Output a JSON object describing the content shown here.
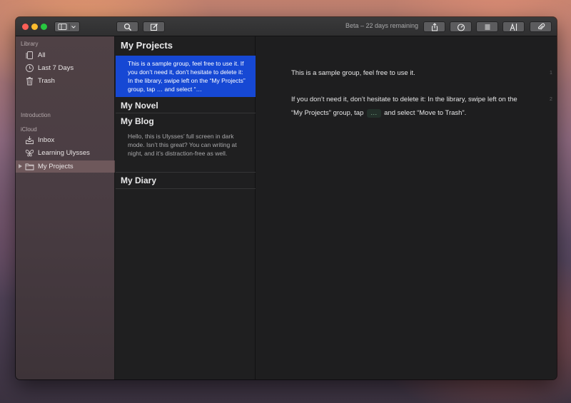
{
  "window": {
    "beta_text": "Beta – 22 days remaining"
  },
  "toolbar": {
    "sidebar_toggle_icon": "sidebar-icon",
    "search_icon": "search-icon",
    "compose_icon": "compose-icon",
    "share_icon": "share-icon",
    "stats_icon": "speedometer-icon",
    "list_icon": "list-icon",
    "text_icon": "text-cursor-icon",
    "attach_icon": "paperclip-icon"
  },
  "sidebar": {
    "library_header": "Library",
    "library_items": [
      {
        "label": "All",
        "icon": "stack-icon"
      },
      {
        "label": "Last 7 Days",
        "icon": "clock-icon"
      },
      {
        "label": "Trash",
        "icon": "trash-icon"
      }
    ],
    "introduction_header": "Introduction",
    "icloud_header": "iCloud",
    "icloud_items": [
      {
        "label": "Inbox",
        "icon": "inbox-icon"
      },
      {
        "label": "Learning Ulysses",
        "icon": "butterfly-icon"
      },
      {
        "label": "My Projects",
        "icon": "folder-icon",
        "selected": true
      }
    ]
  },
  "sheets": {
    "group_title": "My Projects",
    "selected_sheet_text": "This is a sample group, feel free to use it. If you don’t need it, don’t hesitate to delete it: In the library, swipe left on the “My Projects” group, tap … and select “…",
    "groups": [
      {
        "title": "My Novel"
      },
      {
        "title": "My Blog",
        "preview": "Hello, this is Ulysses’ full screen in dark mode. Isn’t this great? You can writing at night, and it’s distraction-free as well."
      },
      {
        "title": "My Diary"
      }
    ]
  },
  "editor": {
    "paragraph1": "This is a sample group, feel free to use it.",
    "paragraph2_a": "If you don’t need it, don’t hesitate to delete it: In the library, swipe left on the “My Projects” group, tap",
    "paragraph2_chip": "…",
    "paragraph2_b": "and select “Move to Trash”.",
    "line_numbers": [
      "1",
      "2"
    ]
  },
  "colors": {
    "selection_blue": "#1648d4",
    "close": "#fc5f57",
    "minimize": "#fdbc2e",
    "maximize": "#28c840"
  }
}
